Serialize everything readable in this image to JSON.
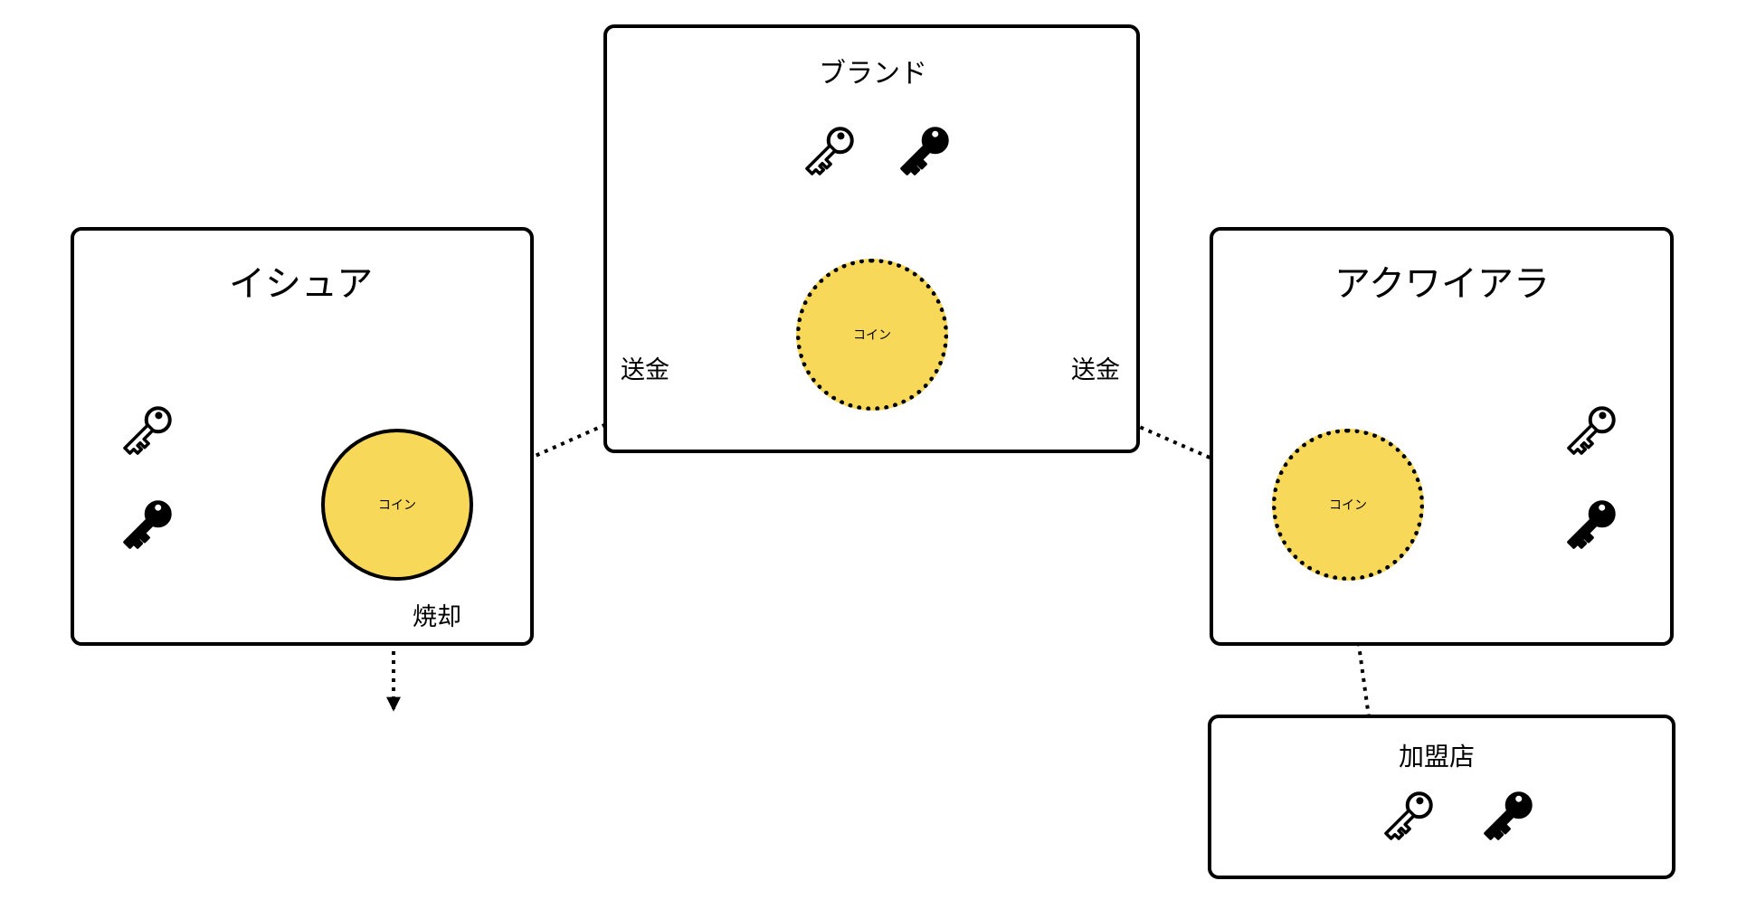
{
  "boxes": {
    "issuer": {
      "title": "イシュア"
    },
    "brand": {
      "title": "ブランド"
    },
    "acquirer": {
      "title": "アクワイアラ"
    },
    "merchant": {
      "title": "加盟店"
    }
  },
  "coin_label": "コイン",
  "labels": {
    "send_left": "送金",
    "send_right": "送金",
    "burn": "焼却"
  },
  "colors": {
    "coin_fill": "#F8D858",
    "stroke": "#000000",
    "background": "#FFFFFF"
  },
  "icons": {
    "public_key": "outlined-key-icon",
    "private_key": "filled-key-icon"
  }
}
